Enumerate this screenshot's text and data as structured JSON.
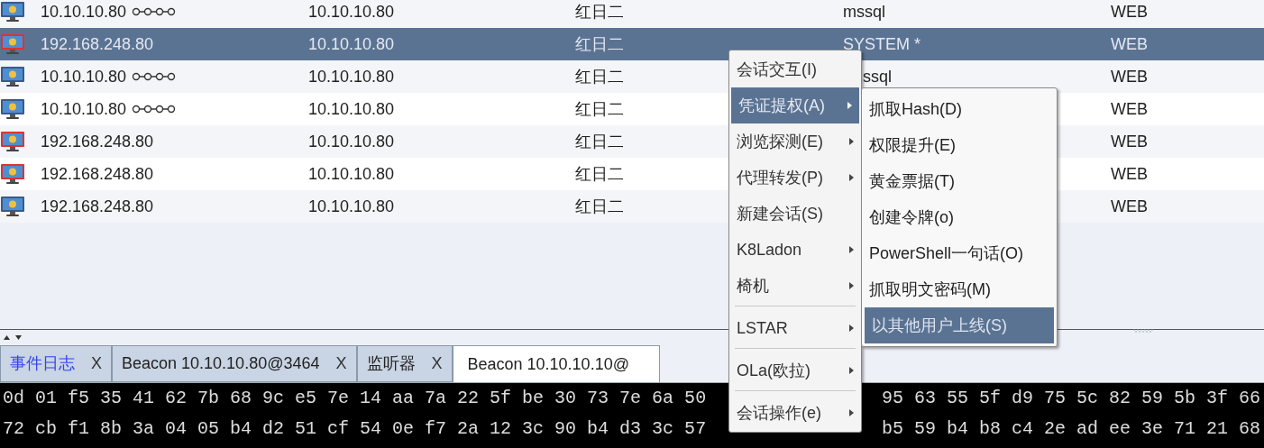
{
  "table": {
    "rows": [
      {
        "elevated": false,
        "external": "10.10.10.80",
        "pivot": true,
        "internal": "10.10.10.80",
        "listener": "红日二",
        "user": "mssql",
        "computer": "WEB",
        "selected": false
      },
      {
        "elevated": true,
        "external": "192.168.248.80",
        "pivot": false,
        "internal": "10.10.10.80",
        "listener": "红日二",
        "user": "SYSTEM *",
        "computer": "WEB",
        "selected": true
      },
      {
        "elevated": false,
        "external": "10.10.10.80",
        "pivot": true,
        "internal": "10.10.10.80",
        "listener": "红日二",
        "user_partial": "ssql",
        "computer": "WEB",
        "selected": false
      },
      {
        "elevated": false,
        "external": "10.10.10.80",
        "pivot": true,
        "internal": "10.10.10.80",
        "listener": "红日二",
        "computer": "WEB",
        "selected": false
      },
      {
        "elevated": true,
        "external": "192.168.248.80",
        "pivot": false,
        "internal": "10.10.10.80",
        "listener": "红日二",
        "computer": "WEB",
        "selected": false
      },
      {
        "elevated": true,
        "external": "192.168.248.80",
        "pivot": false,
        "internal": "10.10.10.80",
        "listener": "红日二",
        "computer": "WEB",
        "selected": false
      },
      {
        "elevated": false,
        "external": "192.168.248.80",
        "pivot": false,
        "internal": "10.10.10.80",
        "listener": "红日二",
        "computer": "WEB",
        "selected": false
      }
    ]
  },
  "tabs": [
    {
      "label": "事件日志",
      "close": "X",
      "selected": false,
      "highlighted": true
    },
    {
      "label": "Beacon 10.10.10.80@3464",
      "close": "X",
      "selected": false,
      "highlighted": false
    },
    {
      "label": "监听器",
      "close": "X",
      "selected": false,
      "highlighted": false
    },
    {
      "label": "Beacon 10.10.10.10@",
      "selected": true,
      "highlighted": false
    }
  ],
  "console": {
    "lines": [
      {
        "left": "0d 01 f5 35 41 62 7b 68 9c e5 7e 14 aa 7a 22 5f be 30 73 7e 6a 50",
        "right": "95 63 55 5f d9 75 5c 82 59 5b 3f 66"
      },
      {
        "left": "72 cb f1 8b 3a 04 05 b4 d2 51 cf 54 0e f7 2a 12 3c 90 b4 d3 3c 57",
        "right": "b5 59 b4 b8 c4 2e ad ee 3e 71 21 68"
      }
    ]
  },
  "context_menu": {
    "items": [
      {
        "kind": "item",
        "label": "会话交互(I)",
        "submenu": false,
        "selected": false
      },
      {
        "kind": "item",
        "label": "凭证提权(A)",
        "submenu": true,
        "selected": true
      },
      {
        "kind": "item",
        "label": "浏览探测(E)",
        "submenu": true,
        "selected": false
      },
      {
        "kind": "item",
        "label": "代理转发(P)",
        "submenu": true,
        "selected": false
      },
      {
        "kind": "item",
        "label": "新建会话(S)",
        "submenu": false,
        "selected": false
      },
      {
        "kind": "item",
        "label": "K8Ladon",
        "submenu": true,
        "selected": false
      },
      {
        "kind": "item",
        "label": "椅机",
        "submenu": true,
        "selected": false
      },
      {
        "kind": "separator"
      },
      {
        "kind": "item",
        "label": "LSTAR",
        "submenu": true,
        "selected": false
      },
      {
        "kind": "separator"
      },
      {
        "kind": "item",
        "label": "OLa(欧拉)",
        "submenu": true,
        "selected": false
      },
      {
        "kind": "separator"
      },
      {
        "kind": "item",
        "label": "会话操作(e)",
        "submenu": true,
        "selected": false
      }
    ]
  },
  "submenu": {
    "items": [
      {
        "label": "抓取Hash(D)",
        "selected": false
      },
      {
        "label": "权限提升(E)",
        "selected": false
      },
      {
        "label": "黄金票据(T)",
        "selected": false
      },
      {
        "label": "创建令牌(o)",
        "selected": false
      },
      {
        "label": "PowerShell一句话(O)",
        "selected": false
      },
      {
        "label": "抓取明文密码(M)",
        "selected": false
      },
      {
        "label": "以其他用户上线(S)",
        "selected": true
      }
    ]
  }
}
